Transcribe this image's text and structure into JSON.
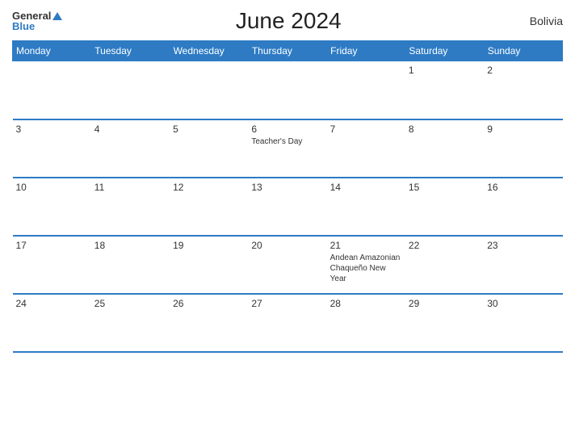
{
  "header": {
    "logo_general": "General",
    "logo_blue": "Blue",
    "title": "June 2024",
    "country": "Bolivia"
  },
  "columns": [
    "Monday",
    "Tuesday",
    "Wednesday",
    "Thursday",
    "Friday",
    "Saturday",
    "Sunday"
  ],
  "weeks": [
    [
      {
        "day": "",
        "empty": true
      },
      {
        "day": "",
        "empty": true
      },
      {
        "day": "",
        "empty": true
      },
      {
        "day": "",
        "empty": true
      },
      {
        "day": "",
        "empty": true
      },
      {
        "day": "1",
        "holiday": ""
      },
      {
        "day": "2",
        "holiday": ""
      }
    ],
    [
      {
        "day": "3",
        "holiday": ""
      },
      {
        "day": "4",
        "holiday": ""
      },
      {
        "day": "5",
        "holiday": ""
      },
      {
        "day": "6",
        "holiday": "Teacher's Day"
      },
      {
        "day": "7",
        "holiday": ""
      },
      {
        "day": "8",
        "holiday": ""
      },
      {
        "day": "9",
        "holiday": ""
      }
    ],
    [
      {
        "day": "10",
        "holiday": ""
      },
      {
        "day": "11",
        "holiday": ""
      },
      {
        "day": "12",
        "holiday": ""
      },
      {
        "day": "13",
        "holiday": ""
      },
      {
        "day": "14",
        "holiday": ""
      },
      {
        "day": "15",
        "holiday": ""
      },
      {
        "day": "16",
        "holiday": ""
      }
    ],
    [
      {
        "day": "17",
        "holiday": ""
      },
      {
        "day": "18",
        "holiday": ""
      },
      {
        "day": "19",
        "holiday": ""
      },
      {
        "day": "20",
        "holiday": ""
      },
      {
        "day": "21",
        "holiday": "Andean Amazonian Chaqueño New Year"
      },
      {
        "day": "22",
        "holiday": ""
      },
      {
        "day": "23",
        "holiday": ""
      }
    ],
    [
      {
        "day": "24",
        "holiday": ""
      },
      {
        "day": "25",
        "holiday": ""
      },
      {
        "day": "26",
        "holiday": ""
      },
      {
        "day": "27",
        "holiday": ""
      },
      {
        "day": "28",
        "holiday": ""
      },
      {
        "day": "29",
        "holiday": ""
      },
      {
        "day": "30",
        "holiday": ""
      }
    ]
  ]
}
